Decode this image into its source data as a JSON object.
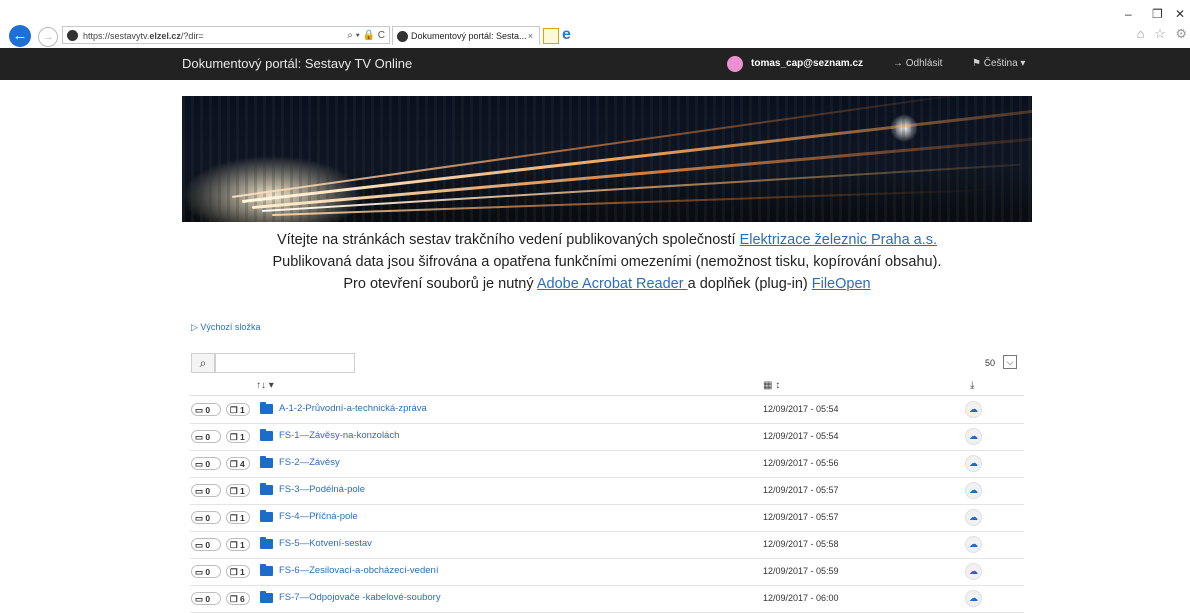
{
  "browser": {
    "url_prefix": "https://sestavytv.",
    "url_domain": "elzel.cz",
    "url_suffix": "/?dir=",
    "address_tools": "⌕ ▾ 🔒 C",
    "tab_title": "Dokumentový portál: Sesta...",
    "tab_close": "×",
    "back": "←",
    "forward": "→",
    "minimize": "–",
    "restore": "❐",
    "close": "✕",
    "fav_icons": "⌂ ☆ ⚙"
  },
  "navbar": {
    "brand": "Dokumentový portál: Sestavy TV Online",
    "user": "tomas_cap@seznam.cz",
    "logout": "→ Odhlásit",
    "language": "⚑ Čeština ▾"
  },
  "intro": {
    "line1_text": "Vítejte na stránkách sestav trakčního vedení publikovaných společností ",
    "line1_link": "Elektrizace železnic Praha a.s.",
    "line2_text": "Publikovaná data jsou šifrována a opatřena funkčními  omezeními (nemožnost tisku, kopírování obsahu).",
    "line3_text": "Pro otevření souborů je nutný ",
    "line3_link1": "Adobe Acrobat Reader ",
    "line3_mid": "a doplňek (plug-in) ",
    "line3_link2": "FileOpen"
  },
  "breadcrumb": "▷ Výchozí složka",
  "search": {
    "icon": "⌕",
    "value": ""
  },
  "page_size": {
    "value": "50",
    "toggle": "⌵"
  },
  "table": {
    "name_header": "↑↓ ▾",
    "date_header": "▦ ↕",
    "download_header": "⤓",
    "rows": [
      {
        "folders": "▭ 0",
        "files": "❐ 1",
        "name": "A-1-2-Průvodní-a-technická-zpráva",
        "date": "12/09/2017 - 05:54",
        "dl": "☁"
      },
      {
        "folders": "▭ 0",
        "files": "❐ 1",
        "name": "FS-1—Závěsy-na-konzolách",
        "date": "12/09/2017 - 05:54",
        "dl": "☁"
      },
      {
        "folders": "▭ 0",
        "files": "❐ 4",
        "name": "FS-2—Závěsy",
        "date": "12/09/2017 - 05:56",
        "dl": "☁"
      },
      {
        "folders": "▭ 0",
        "files": "❐ 1",
        "name": "FS-3—Podélná-pole",
        "date": "12/09/2017 - 05:57",
        "dl": "☁"
      },
      {
        "folders": "▭ 0",
        "files": "❐ 1",
        "name": "FS-4—Příčná-pole",
        "date": "12/09/2017 - 05:57",
        "dl": "☁"
      },
      {
        "folders": "▭ 0",
        "files": "❐ 1",
        "name": "FS-5—Kotvení-sestav",
        "date": "12/09/2017 - 05:58",
        "dl": "☁"
      },
      {
        "folders": "▭ 0",
        "files": "❐ 1",
        "name": "FS-6—Zesilovací-a-obcházecí-vedení",
        "date": "12/09/2017 - 05:59",
        "dl": "☁"
      },
      {
        "folders": "▭ 0",
        "files": "❐ 6",
        "name": "FS-7—Odpojovače -kabelové-soubory",
        "date": "12/09/2017 - 06:00",
        "dl": "☁"
      }
    ]
  }
}
